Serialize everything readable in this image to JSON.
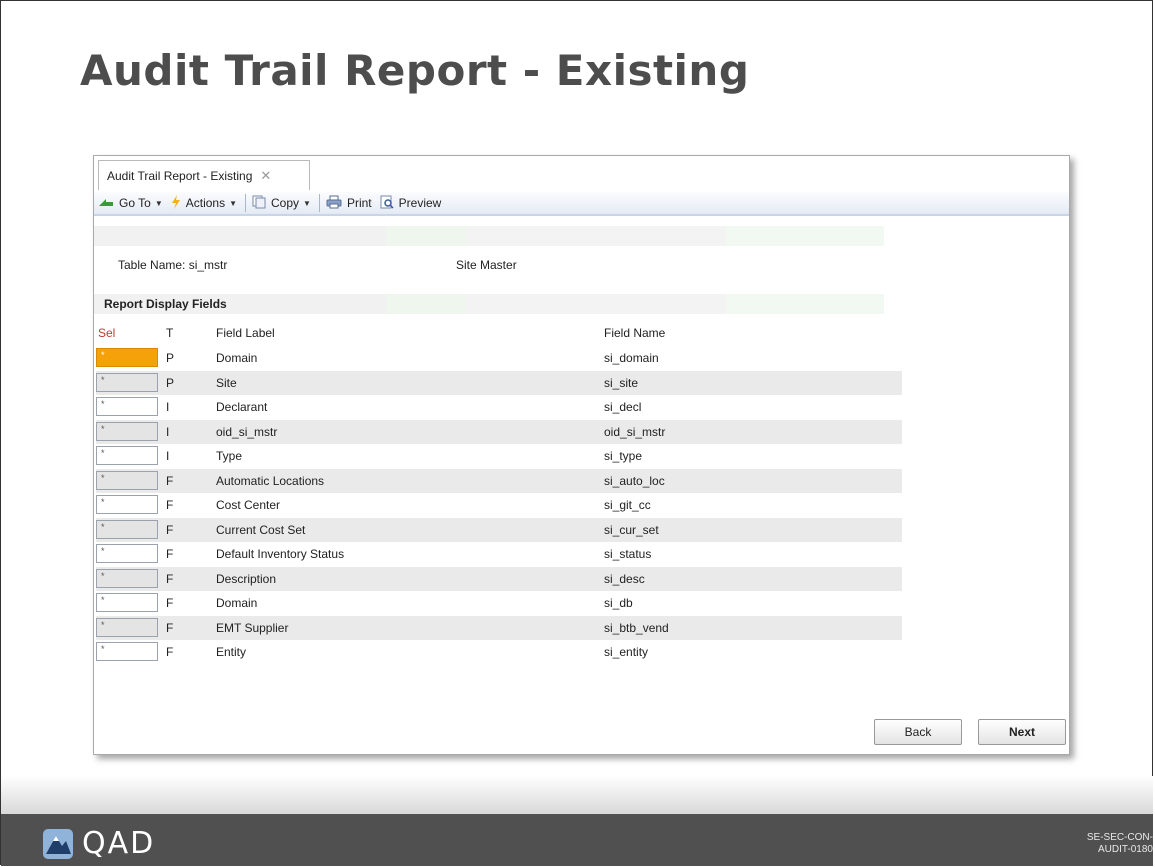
{
  "slide": {
    "title": "Audit Trail Report - Existing",
    "footer_code_line1": "SE-SEC-CON-",
    "footer_code_line2": "AUDIT-0180",
    "logo_text": "QAD"
  },
  "window": {
    "tab_label": "Audit Trail Report - Existing",
    "tab_close": "✕",
    "toolbar": {
      "goto_label": "Go To",
      "actions_label": "Actions",
      "copy_label": "Copy",
      "print_label": "Print",
      "preview_label": "Preview"
    },
    "table_name_label": "Table Name:",
    "table_name_value": "si_mstr",
    "table_description": "Site Master",
    "section_header": "Report Display Fields",
    "columns": {
      "sel": "Sel",
      "t": "T",
      "label": "Field Label",
      "name": "Field Name"
    },
    "rows": [
      {
        "sel": "*",
        "t": "P",
        "label": "Domain",
        "name": "si_domain"
      },
      {
        "sel": "*",
        "t": "P",
        "label": "Site",
        "name": "si_site"
      },
      {
        "sel": "*",
        "t": "I",
        "label": "Declarant",
        "name": "si_decl"
      },
      {
        "sel": "*",
        "t": "I",
        "label": "oid_si_mstr",
        "name": "oid_si_mstr"
      },
      {
        "sel": "*",
        "t": "I",
        "label": "Type",
        "name": "si_type"
      },
      {
        "sel": "*",
        "t": "F",
        "label": "Automatic Locations",
        "name": "si_auto_loc"
      },
      {
        "sel": "*",
        "t": "F",
        "label": "Cost Center",
        "name": "si_git_cc"
      },
      {
        "sel": "*",
        "t": "F",
        "label": "Current Cost Set",
        "name": "si_cur_set"
      },
      {
        "sel": "*",
        "t": "F",
        "label": "Default Inventory Status",
        "name": "si_status"
      },
      {
        "sel": "*",
        "t": "F",
        "label": "Description",
        "name": "si_desc"
      },
      {
        "sel": "*",
        "t": "F",
        "label": "Domain",
        "name": "si_db"
      },
      {
        "sel": "*",
        "t": "F",
        "label": "EMT Supplier",
        "name": "si_btb_vend"
      },
      {
        "sel": "*",
        "t": "F",
        "label": "Entity",
        "name": "si_entity"
      }
    ],
    "back_label": "Back",
    "next_label": "Next"
  },
  "colors": {
    "active_cell": "#f5a20a",
    "sel_header": "#c0392b",
    "footer_bar": "#505050"
  }
}
